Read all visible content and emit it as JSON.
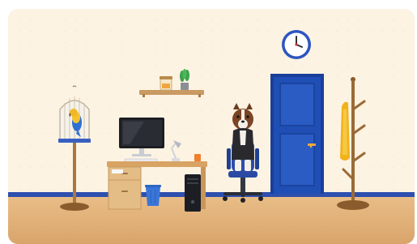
{
  "scene": {
    "wall_color": "#fdf3e2",
    "floor_color": "#e4b47c",
    "baseboard_color": "#2e4fae",
    "objects": [
      {
        "id": "wall-clock",
        "icon": "clock-icon"
      },
      {
        "id": "wall-shelf",
        "icon": "shelf-icon",
        "items": [
          "jar",
          "potted-plant"
        ]
      },
      {
        "id": "birdcage",
        "icon": "birdcage-icon",
        "contents": "parrot"
      },
      {
        "id": "computer-desk",
        "icon": "desk-icon",
        "items": [
          "monitor",
          "keyboard",
          "desk-lamp",
          "mug"
        ]
      },
      {
        "id": "trash-can",
        "icon": "trash-can-icon"
      },
      {
        "id": "pc-tower",
        "icon": "pc-tower-icon"
      },
      {
        "id": "office-chair",
        "icon": "office-chair-icon",
        "occupant": "dog"
      },
      {
        "id": "door",
        "icon": "door-icon",
        "color": "#1f4fb5"
      },
      {
        "id": "coat-rack",
        "icon": "coat-rack-icon",
        "items": [
          "yellow-raincoat"
        ]
      }
    ]
  }
}
